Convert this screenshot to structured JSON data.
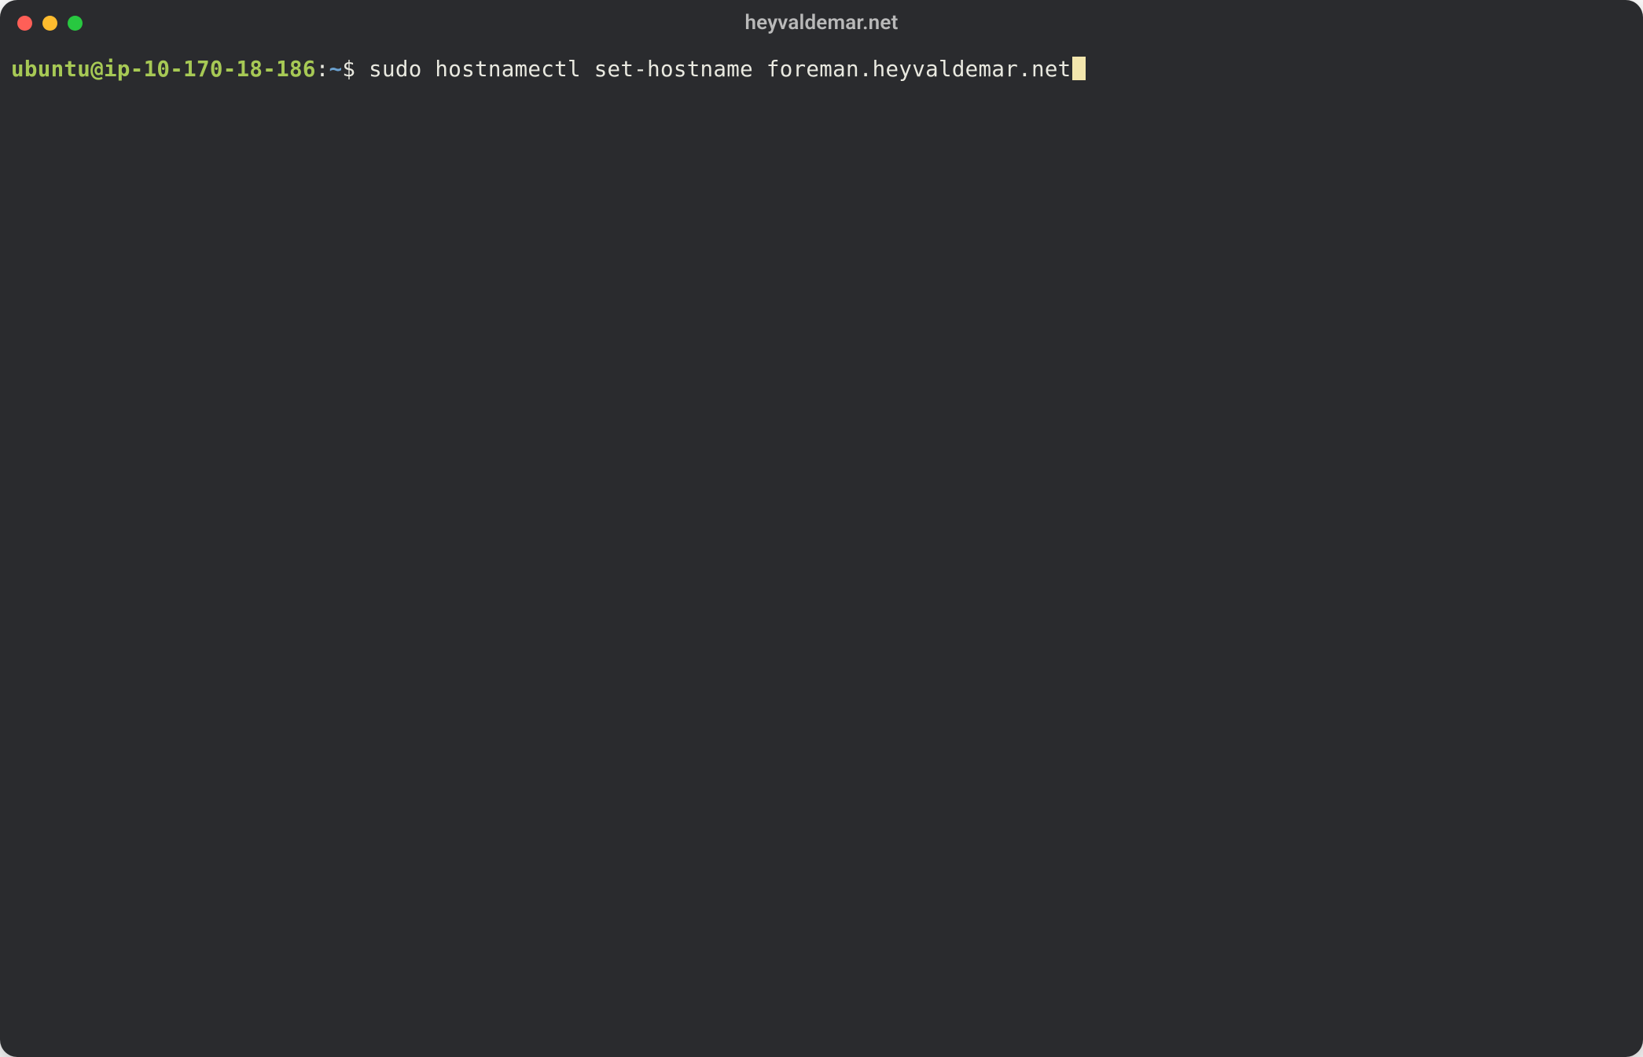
{
  "window": {
    "title": "heyvaldemar.net",
    "traffic_lights": {
      "close": "close-icon",
      "minimize": "minimize-icon",
      "zoom": "zoom-icon"
    }
  },
  "prompt": {
    "user_host": "ubuntu@ip-10-170-18-186",
    "colon": ":",
    "path": "~",
    "symbol": "$"
  },
  "command": {
    "text": "sudo hostnamectl set-hostname foreman.heyvaldemar.net"
  },
  "colors": {
    "bg": "#2a2b2e",
    "text": "#e9e9e0",
    "user": "#a7c955",
    "path": "#6aa0cf",
    "cursor": "#f3e6ad",
    "title": "#b9b9b9"
  }
}
